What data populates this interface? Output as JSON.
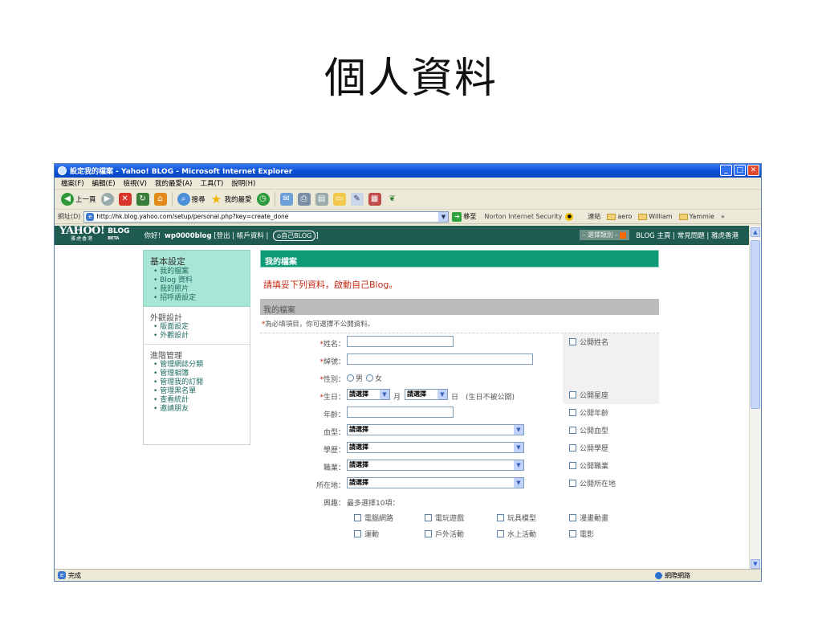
{
  "slide_title": "個人資料",
  "window": {
    "title": "設定我的檔案 - Yahoo! BLOG - Microsoft Internet Explorer",
    "buttons": [
      "_",
      "□",
      "✕"
    ]
  },
  "menu": [
    "檔案(F)",
    "編輯(E)",
    "檢視(V)",
    "我的最愛(A)",
    "工具(T)",
    "說明(H)"
  ],
  "toolbar": {
    "back": "上一頁",
    "search": "搜尋",
    "favorites": "我的最愛"
  },
  "addressbar": {
    "label": "網址(D)",
    "url": "http://hk.blog.yahoo.com/setup/personal.php?key=create_done",
    "go": "移至",
    "norton": "Norton Internet Security",
    "links_label": "連結",
    "links": [
      "aero",
      "William",
      "Yammie"
    ],
    "more": "»"
  },
  "yahoo": {
    "logo": "YAHOO!",
    "logo_sub": "雅虎香港",
    "blog": "BLOG",
    "beta": "BETA",
    "greeting_prefix": "你好！",
    "user": "wp0000blog",
    "user_links": "[登出 | 帳戶資料 |",
    "my_blog": "自己BLOG",
    "close_bracket": "]",
    "category": "- 選擇類別 -",
    "right_links": "BLOG 主頁 | 常見問題 | 雅虎香港"
  },
  "sidebar": {
    "basic": {
      "title": "基本設定",
      "items": [
        "我的檔案",
        "Blog 資料",
        "我的照片",
        "招呼語設定"
      ]
    },
    "appearance": {
      "title": "外觀設計",
      "items": [
        "版面設定",
        "外觀設計"
      ]
    },
    "advanced": {
      "title": "進階管理",
      "items": [
        "管理網誌分類",
        "管理相簿",
        "管理我的訂閱",
        "管理黑名單",
        "查看統計",
        "邀請朋友"
      ]
    }
  },
  "main": {
    "header": "我的檔案",
    "notice": "請填妥下列資料，啟動自己Blog。",
    "form_header": "我的檔案",
    "required_star": "*",
    "required_note": "為必填項目，你可選擇不公開資料。",
    "fields": {
      "name": "姓名：",
      "nickname": "綽號：",
      "gender": "性別：",
      "male": "男",
      "female": "女",
      "birthday": "生日：",
      "select": "請選擇",
      "month": "月",
      "day": "日",
      "birthday_note": "(生日不被公開)",
      "age": "年齡：",
      "blood": "血型：",
      "education": "學歷：",
      "occupation": "職業：",
      "location": "所在地：",
      "interests": "興趣：",
      "interests_note": "最多選擇10項："
    },
    "public": {
      "name": "公開姓名",
      "zodiac": "公開星座",
      "age": "公開年齡",
      "blood": "公開血型",
      "education": "公開學歷",
      "occupation": "公開職業",
      "location": "公開所在地"
    },
    "hobbies": [
      "電腦網路",
      "電玩遊戲",
      "玩具模型",
      "漫畫動畫",
      "運動",
      "戶外活動",
      "水上活動",
      "電影"
    ]
  },
  "status": {
    "done": "完成",
    "zone": "網際網路"
  }
}
